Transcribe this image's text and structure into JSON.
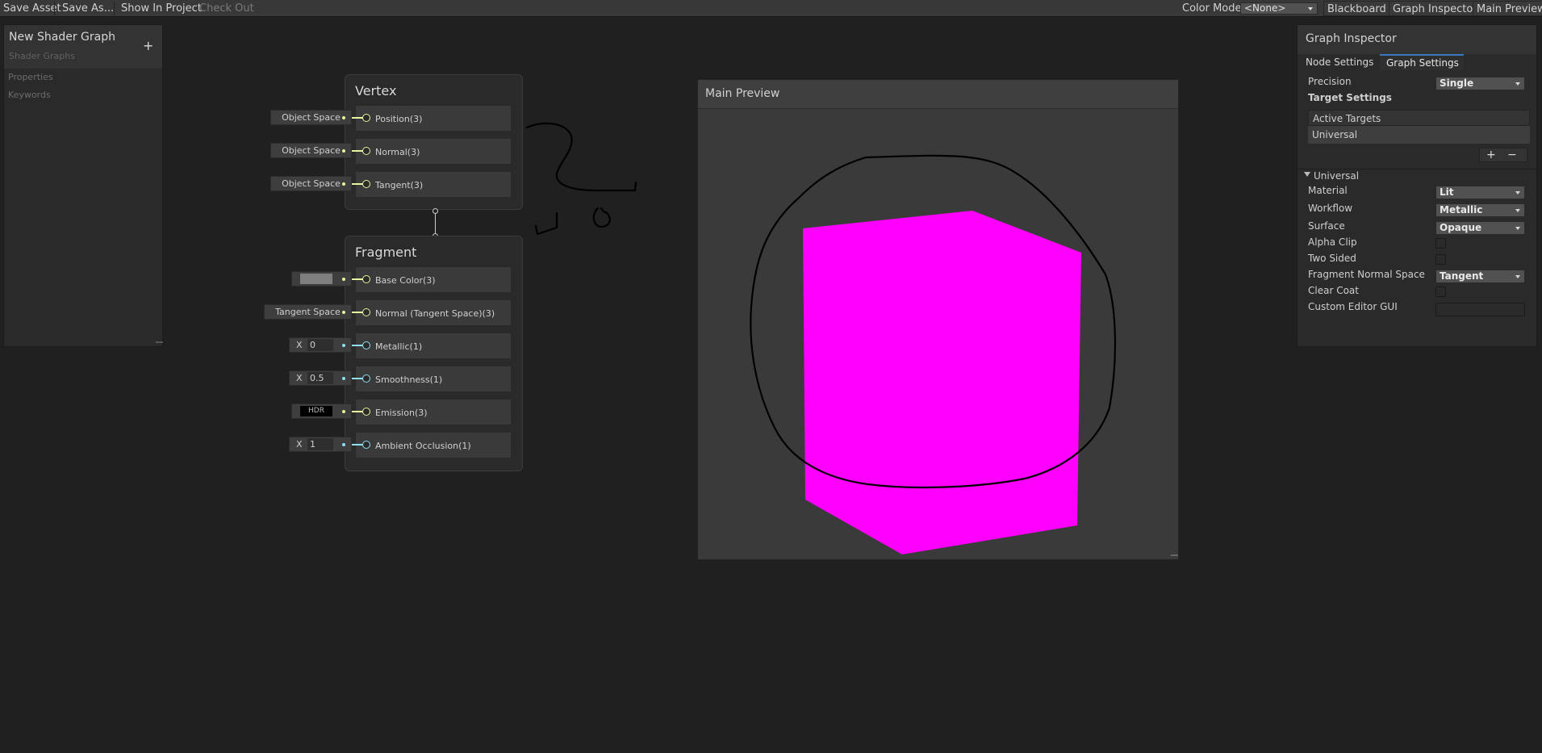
{
  "toolbar": {
    "save_asset": "Save Asset",
    "save_as": "Save As...",
    "show_in_project": "Show In Project",
    "check_out": "Check Out",
    "color_mode_label": "Color Mode",
    "color_mode_value": "<None>",
    "blackboard": "Blackboard",
    "graph_inspector": "Graph Inspector",
    "main_preview": "Main Preview"
  },
  "blackboard": {
    "title": "New Shader Graph",
    "subtitle": "Shader Graphs",
    "add": "+",
    "sections": [
      "Properties",
      "Keywords"
    ]
  },
  "vertex": {
    "title": "Vertex",
    "ports": [
      {
        "label": "Position(3)",
        "input": "Object Space"
      },
      {
        "label": "Normal(3)",
        "input": "Object Space"
      },
      {
        "label": "Tangent(3)",
        "input": "Object Space"
      }
    ]
  },
  "fragment": {
    "title": "Fragment",
    "ports": [
      {
        "label": "Base Color(3)",
        "input": ""
      },
      {
        "label": "Normal (Tangent Space)(3)",
        "input": "Tangent Space"
      },
      {
        "label": "Metallic(1)",
        "input_prefix": "X",
        "input": "0"
      },
      {
        "label": "Smoothness(1)",
        "input_prefix": "X",
        "input": "0.5"
      },
      {
        "label": "Emission(3)",
        "input": "HDR"
      },
      {
        "label": "Ambient Occlusion(1)",
        "input_prefix": "X",
        "input": "1"
      }
    ]
  },
  "preview": {
    "title": "Main Preview",
    "cube_color": "#ff00ff"
  },
  "inspector": {
    "title": "Graph Inspector",
    "tabs": [
      "Node Settings",
      "Graph Settings"
    ],
    "active_tab": "Graph Settings",
    "precision_label": "Precision",
    "precision_value": "Single",
    "target_settings": "Target Settings",
    "active_targets": "Active Targets",
    "target_item": "Universal",
    "add": "+",
    "remove": "−",
    "universal_section": "Universal",
    "material_label": "Material",
    "material_value": "Lit",
    "workflow_label": "Workflow",
    "workflow_value": "Metallic",
    "surface_label": "Surface",
    "surface_value": "Opaque",
    "alpha_clip_label": "Alpha Clip",
    "two_sided_label": "Two Sided",
    "fns_label": "Fragment Normal Space",
    "fns_value": "Tangent",
    "clear_coat_label": "Clear Coat",
    "custom_gui_label": "Custom Editor GUI",
    "custom_gui_value": ""
  },
  "colors": {
    "vec3_port": "#e9f29c",
    "vec1_port": "#8ee0ef",
    "accent_tab": "#3a79bb"
  }
}
